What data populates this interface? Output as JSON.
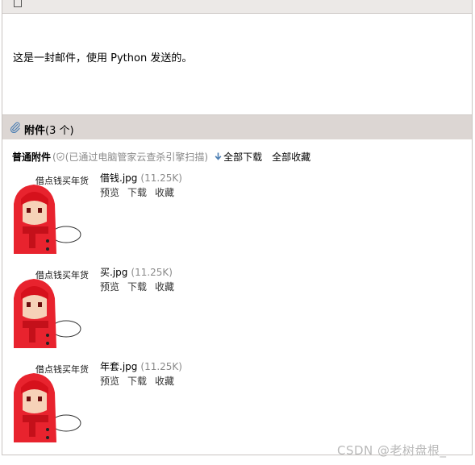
{
  "mail": {
    "body_text": "这是一封邮件，使用 Python 发送的。"
  },
  "attachments": {
    "title": "附件",
    "count_text": "(3 个)",
    "normal_label": "普通附件",
    "scan_text": "(已通过电脑管家云查杀引擎扫描)",
    "download_all": "全部下载",
    "save_all": "全部收藏",
    "thumb_caption": "借点钱买年货",
    "items": [
      {
        "name": "借钱.jpg",
        "size": "(11.25K)",
        "preview": "预览",
        "download": "下载",
        "save": "收藏"
      },
      {
        "name": "买.jpg",
        "size": "(11.25K)",
        "preview": "预览",
        "download": "下载",
        "save": "收藏"
      },
      {
        "name": "年套.jpg",
        "size": "(11.25K)",
        "preview": "预览",
        "download": "下载",
        "save": "收藏"
      }
    ]
  },
  "watermark": "CSDN @老树盘根_",
  "colors": {
    "header_bg": "#dcd6d3",
    "muted_text": "#8a8a8a",
    "download_arrow": "#4d7fb3"
  }
}
